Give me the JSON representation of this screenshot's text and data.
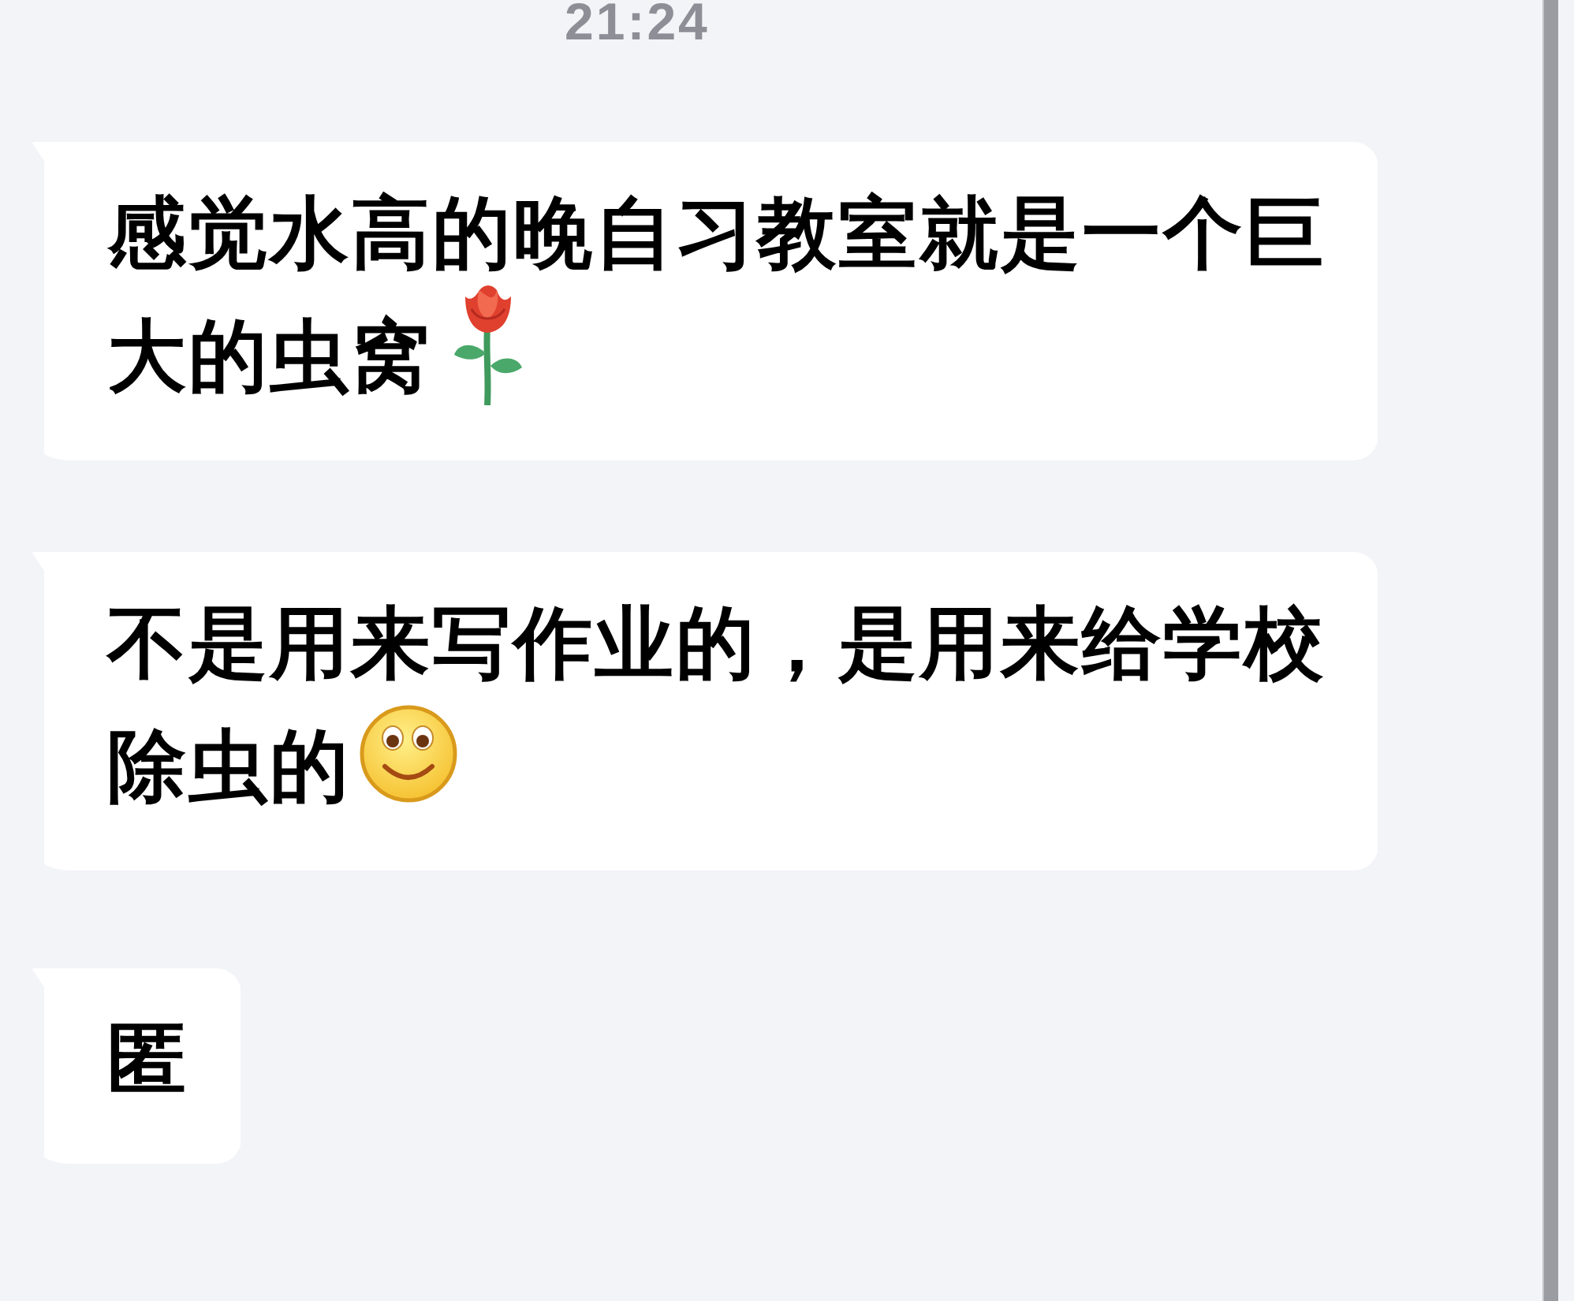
{
  "timestamp": "21:24",
  "messages": [
    {
      "kind": "rose",
      "lines": [
        "感觉水高的晚自习教室就是一个巨",
        "大的虫窝"
      ]
    },
    {
      "kind": "smile",
      "lines": [
        "不是用来写作业的，是用来给学校",
        "除虫的"
      ]
    },
    {
      "kind": "plain",
      "lines": [
        "匿"
      ]
    }
  ]
}
